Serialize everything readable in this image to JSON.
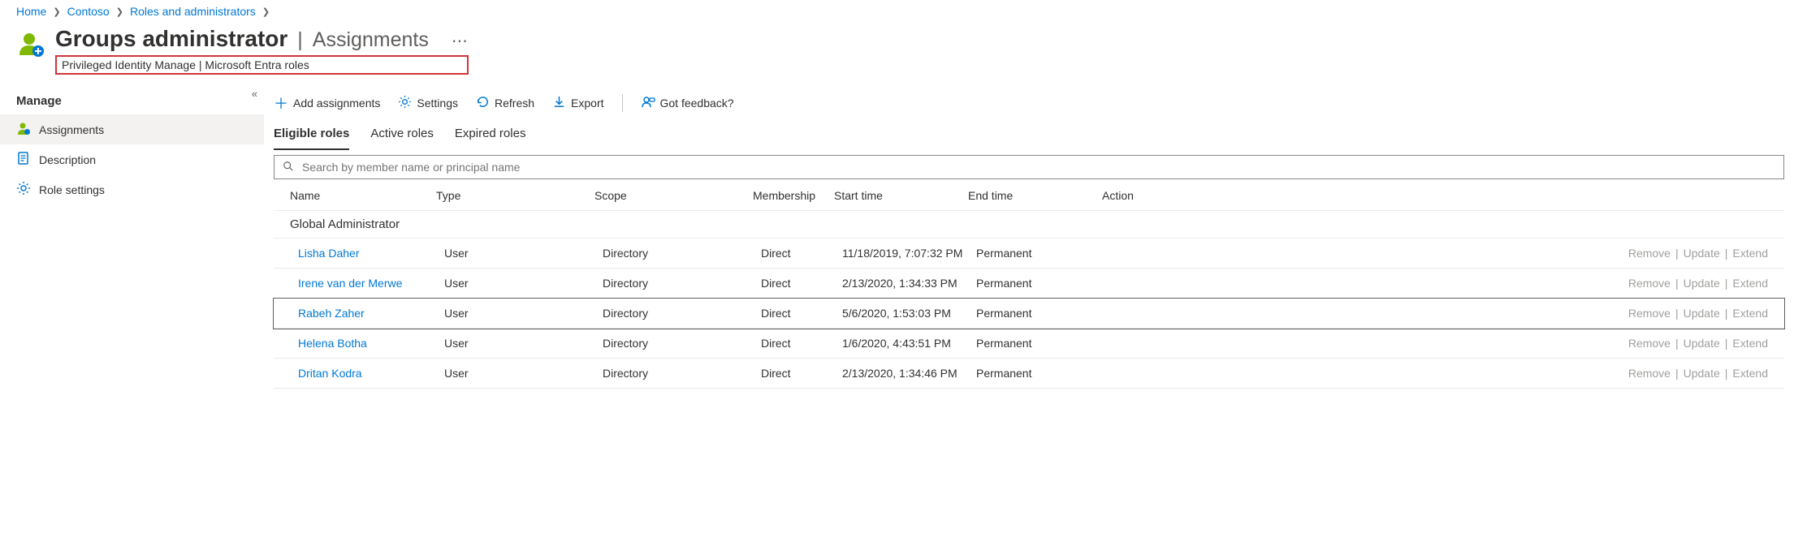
{
  "breadcrumb": [
    {
      "label": "Home"
    },
    {
      "label": "Contoso"
    },
    {
      "label": "Roles and administrators"
    }
  ],
  "page": {
    "title": "Groups administrator",
    "section": "Assignments",
    "subtitle": "Privileged Identity Manage | Microsoft Entra roles"
  },
  "sidebar": {
    "group": "Manage",
    "items": [
      {
        "label": "Assignments",
        "active": true
      },
      {
        "label": "Description",
        "active": false
      },
      {
        "label": "Role settings",
        "active": false
      }
    ]
  },
  "toolbar": {
    "add": "Add assignments",
    "settings": "Settings",
    "refresh": "Refresh",
    "export": "Export",
    "feedback": "Got feedback?"
  },
  "tabs": [
    {
      "label": "Eligible roles",
      "active": true
    },
    {
      "label": "Active roles",
      "active": false
    },
    {
      "label": "Expired roles",
      "active": false
    }
  ],
  "search": {
    "placeholder": "Search by member name or principal name"
  },
  "columns": {
    "name": "Name",
    "type": "Type",
    "scope": "Scope",
    "membership": "Membership",
    "start": "Start time",
    "end": "End time",
    "action": "Action"
  },
  "group_header": "Global Administrator",
  "actions": {
    "remove": "Remove",
    "update": "Update",
    "extend": "Extend"
  },
  "rows": [
    {
      "name": "Lisha Daher",
      "type": "User",
      "scope": "Directory",
      "membership": "Direct",
      "start": "11/18/2019, 7:07:32 PM",
      "end": "Permanent",
      "selected": false
    },
    {
      "name": "Irene van der Merwe",
      "type": "User",
      "scope": "Directory",
      "membership": "Direct",
      "start": "2/13/2020, 1:34:33 PM",
      "end": "Permanent",
      "selected": false
    },
    {
      "name": "Rabeh Zaher",
      "type": "User",
      "scope": "Directory",
      "membership": "Direct",
      "start": "5/6/2020, 1:53:03 PM",
      "end": "Permanent",
      "selected": true
    },
    {
      "name": "Helena Botha",
      "type": "User",
      "scope": "Directory",
      "membership": "Direct",
      "start": "1/6/2020, 4:43:51 PM",
      "end": "Permanent",
      "selected": false
    },
    {
      "name": "Dritan Kodra",
      "type": "User",
      "scope": "Directory",
      "membership": "Direct",
      "start": "2/13/2020, 1:34:46 PM",
      "end": "Permanent",
      "selected": false
    }
  ]
}
